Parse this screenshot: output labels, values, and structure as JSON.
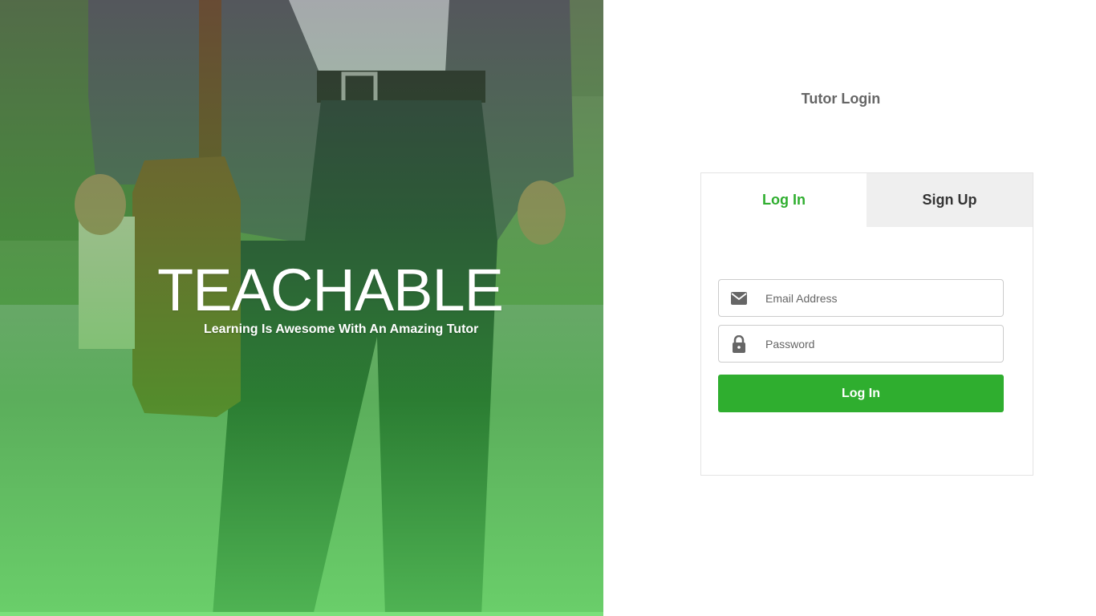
{
  "hero": {
    "brand": "TEACHABLE",
    "tagline": "Learning Is Awesome With An Amazing Tutor"
  },
  "login": {
    "title": "Tutor Login",
    "tabs": [
      {
        "label": "Log In",
        "active": true
      },
      {
        "label": "Sign Up",
        "active": false
      }
    ],
    "email": {
      "placeholder": "Email Address",
      "value": "",
      "icon": "envelope-icon"
    },
    "password": {
      "placeholder": "Password",
      "value": "",
      "icon": "lock-icon"
    },
    "submit_label": "Log In"
  },
  "colors": {
    "accent": "#2fae2f",
    "inactive_tab_bg": "#efefef",
    "title_text": "#666666"
  }
}
